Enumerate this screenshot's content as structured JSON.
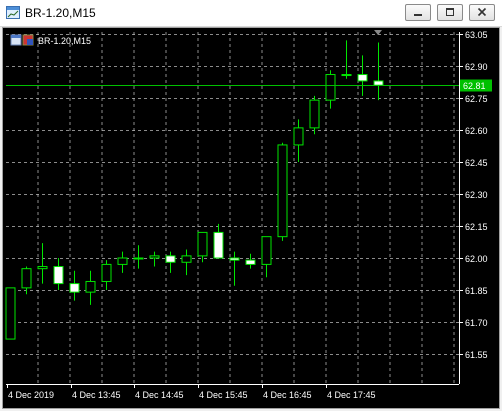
{
  "window": {
    "title": "BR-1.20,M15",
    "buttons": {
      "minimize": "minimize",
      "maximize": "maximize",
      "close": "close"
    }
  },
  "chart_label": "BR-1.20,M15",
  "colors": {
    "background": "#000000",
    "grid": "#c8c8c8",
    "candle_outline": "#00e600",
    "bull_fill": "#000000",
    "bear_fill": "#ffffff",
    "axis_text": "#ffffff",
    "price_line": "#00c000",
    "price_badge": "#00c000"
  },
  "chart_data": {
    "type": "candlestick",
    "symbol": "BR-1.20",
    "timeframe": "M15",
    "current_price": "62.81",
    "y_ticks": [
      "63.05",
      "62.90",
      "62.75",
      "62.60",
      "62.45",
      "62.30",
      "62.15",
      "62.00",
      "61.85",
      "61.70",
      "61.55"
    ],
    "x_ticks": [
      "4 Dec 2019",
      "4 Dec 13:45",
      "4 Dec 14:45",
      "4 Dec 15:45",
      "4 Dec 16:45",
      "4 Dec 17:45"
    ],
    "candles": [
      {
        "o": 61.62,
        "h": 61.86,
        "l": 61.62,
        "c": 61.86
      },
      {
        "o": 61.86,
        "h": 61.96,
        "l": 61.83,
        "c": 61.95
      },
      {
        "o": 61.95,
        "h": 62.07,
        "l": 61.88,
        "c": 61.96
      },
      {
        "o": 61.96,
        "h": 62.0,
        "l": 61.85,
        "c": 61.88
      },
      {
        "o": 61.88,
        "h": 61.94,
        "l": 61.8,
        "c": 61.84
      },
      {
        "o": 61.84,
        "h": 61.94,
        "l": 61.78,
        "c": 61.89
      },
      {
        "o": 61.89,
        "h": 61.99,
        "l": 61.85,
        "c": 61.97
      },
      {
        "o": 61.97,
        "h": 62.03,
        "l": 61.93,
        "c": 62.0
      },
      {
        "o": 62.0,
        "h": 62.06,
        "l": 61.95,
        "c": 62.0
      },
      {
        "o": 62.0,
        "h": 62.03,
        "l": 61.96,
        "c": 62.01
      },
      {
        "o": 62.01,
        "h": 62.03,
        "l": 61.93,
        "c": 61.98
      },
      {
        "o": 61.98,
        "h": 62.04,
        "l": 61.92,
        "c": 62.01
      },
      {
        "o": 62.01,
        "h": 62.12,
        "l": 61.98,
        "c": 62.12
      },
      {
        "o": 62.12,
        "h": 62.16,
        "l": 62.0,
        "c": 62.0
      },
      {
        "o": 62.0,
        "h": 62.03,
        "l": 61.87,
        "c": 61.99
      },
      {
        "o": 61.99,
        "h": 62.02,
        "l": 61.95,
        "c": 61.97
      },
      {
        "o": 61.97,
        "h": 62.1,
        "l": 61.91,
        "c": 62.1
      },
      {
        "o": 62.1,
        "h": 62.54,
        "l": 62.08,
        "c": 62.53
      },
      {
        "o": 62.53,
        "h": 62.65,
        "l": 62.45,
        "c": 62.61
      },
      {
        "o": 62.61,
        "h": 62.76,
        "l": 62.58,
        "c": 62.74
      },
      {
        "o": 62.74,
        "h": 62.88,
        "l": 62.7,
        "c": 62.86
      },
      {
        "o": 62.86,
        "h": 63.02,
        "l": 62.84,
        "c": 62.86
      },
      {
        "o": 62.86,
        "h": 62.95,
        "l": 62.76,
        "c": 62.83
      },
      {
        "o": 62.83,
        "h": 63.01,
        "l": 62.74,
        "c": 62.81
      }
    ],
    "grid": true
  }
}
